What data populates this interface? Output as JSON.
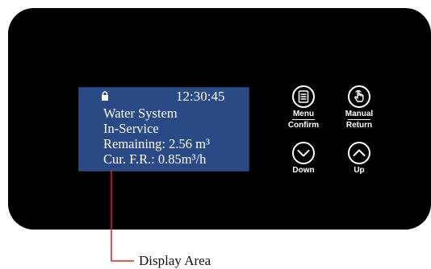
{
  "display": {
    "clock": "12:30:45",
    "lines": [
      "Water System",
      "In-Service",
      "Remaining: 2.56 m³",
      "Cur. F.R.: 0.85m³/h"
    ],
    "background_color": "#2a4a86",
    "status_icon": "lock-icon"
  },
  "buttons": {
    "menu_confirm": {
      "label_top": "Menu",
      "label_bottom": "Confirm",
      "icon": "list-icon"
    },
    "manual_return": {
      "label_top": "Manual",
      "label_bottom": "Return",
      "icon": "hand-pointer-icon"
    },
    "down": {
      "label": "Down",
      "icon": "chevron-down-icon"
    },
    "up": {
      "label": "Up",
      "icon": "chevron-up-icon"
    }
  },
  "callout": {
    "label": "Display Area",
    "line_color": "#e02020"
  },
  "panel": {
    "color": "#000000"
  }
}
